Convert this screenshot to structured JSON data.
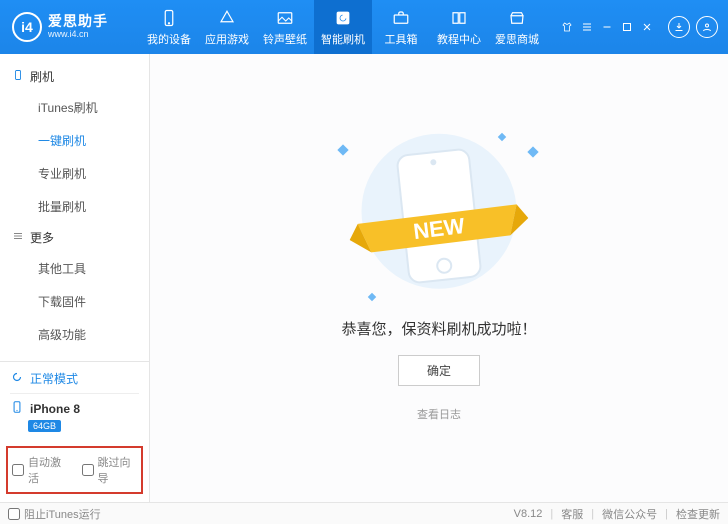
{
  "brand": {
    "name": "爱思助手",
    "url": "www.i4.cn",
    "logo_text": "i4"
  },
  "nav": {
    "items": [
      {
        "label": "我的设备"
      },
      {
        "label": "应用游戏"
      },
      {
        "label": "铃声壁纸"
      },
      {
        "label": "智能刷机"
      },
      {
        "label": "工具箱"
      },
      {
        "label": "教程中心"
      },
      {
        "label": "爱思商城"
      }
    ],
    "active_index": 3
  },
  "sidebar": {
    "sections": [
      {
        "title": "刷机",
        "items": [
          "iTunes刷机",
          "一键刷机",
          "专业刷机",
          "批量刷机"
        ],
        "active_index": 1
      },
      {
        "title": "更多",
        "items": [
          "其他工具",
          "下载固件",
          "高级功能"
        ],
        "active_index": -1
      }
    ]
  },
  "device": {
    "mode_label": "正常模式",
    "name": "iPhone 8",
    "capacity": "64GB"
  },
  "options": {
    "auto_activate": "自动激活",
    "skip_wizard": "跳过向导"
  },
  "main": {
    "ribbon_text": "NEW",
    "success_text": "恭喜您，保资料刷机成功啦！",
    "ok_button": "确定",
    "view_log": "查看日志"
  },
  "footer": {
    "block_itunes": "阻止iTunes运行",
    "version": "V8.12",
    "support": "客服",
    "wechat": "微信公众号",
    "check_update": "检查更新"
  }
}
